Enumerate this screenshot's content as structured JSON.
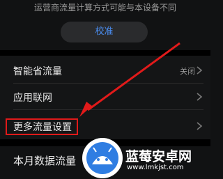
{
  "notice": "运营商流量计算方式可能与本设备不同",
  "calibrate_button": "校准",
  "rows": [
    {
      "label": "智能省流量",
      "value": "关闭"
    },
    {
      "label": "应用联网",
      "value": ""
    },
    {
      "label": "更多流量设置",
      "value": ""
    }
  ],
  "bottom_row": {
    "label": "本月数据流量"
  },
  "watermark": {
    "title": "蓝莓安卓网",
    "url": "www.lmkjst.com"
  },
  "colors": {
    "accent": "#4a8df0",
    "highlight": "#e11a1a",
    "background": "#111213"
  },
  "icons": [
    "chevron-right-icon",
    "android-logo-icon"
  ]
}
